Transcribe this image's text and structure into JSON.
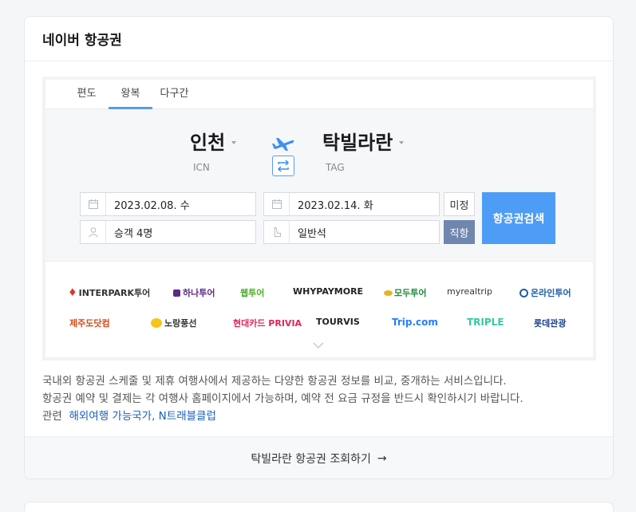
{
  "header": {
    "title": "네이버 항공권"
  },
  "tabs": [
    {
      "label": "편도"
    },
    {
      "label": "왕복"
    },
    {
      "label": "다구간"
    }
  ],
  "active_tab": "왕복",
  "route": {
    "from": {
      "city": "인천",
      "code": "ICN"
    },
    "to": {
      "city": "탁빌라란",
      "code": "TAG"
    }
  },
  "fields": {
    "depart_date": "2023.02.08. 수",
    "return_date": "2023.02.14. 화",
    "passengers": "승객 4명",
    "seat_class": "일반석"
  },
  "buttons": {
    "undecided": "미정",
    "direct": "직항",
    "search": "항공권검색"
  },
  "partners": [
    "INTERPARK투어",
    "하나투어",
    "웹투어",
    "WHYPAYMORE",
    "모두투어",
    "myrealtrip",
    "온라인투어",
    "제주도닷컴",
    "노랑풍선",
    "현대카드 PRIVIA",
    "TOURVIS",
    "Trip.com",
    "TRIPLE",
    "롯데관광"
  ],
  "description": {
    "line1": "국내외 항공권 스케줄 및 제휴 여행사에서 제공하는 다양한 항공권 정보를 비교, 중개하는 서비스입니다.",
    "line2": "항공권 예약 및 결제는 각 여행사 홈페이지에서 가능하며, 예약 전 요금 규정을 반드시 확인하시기 바랍니다.",
    "related_label": "관련",
    "related_links": "해외여행 가능국가, N트래블클럽"
  },
  "footer": {
    "label": "탁빌라란 항공권 조회하기"
  },
  "colors": {
    "accent": "#4d9cf5",
    "direct_button": "#6f86ad",
    "link": "#1a5fba"
  }
}
